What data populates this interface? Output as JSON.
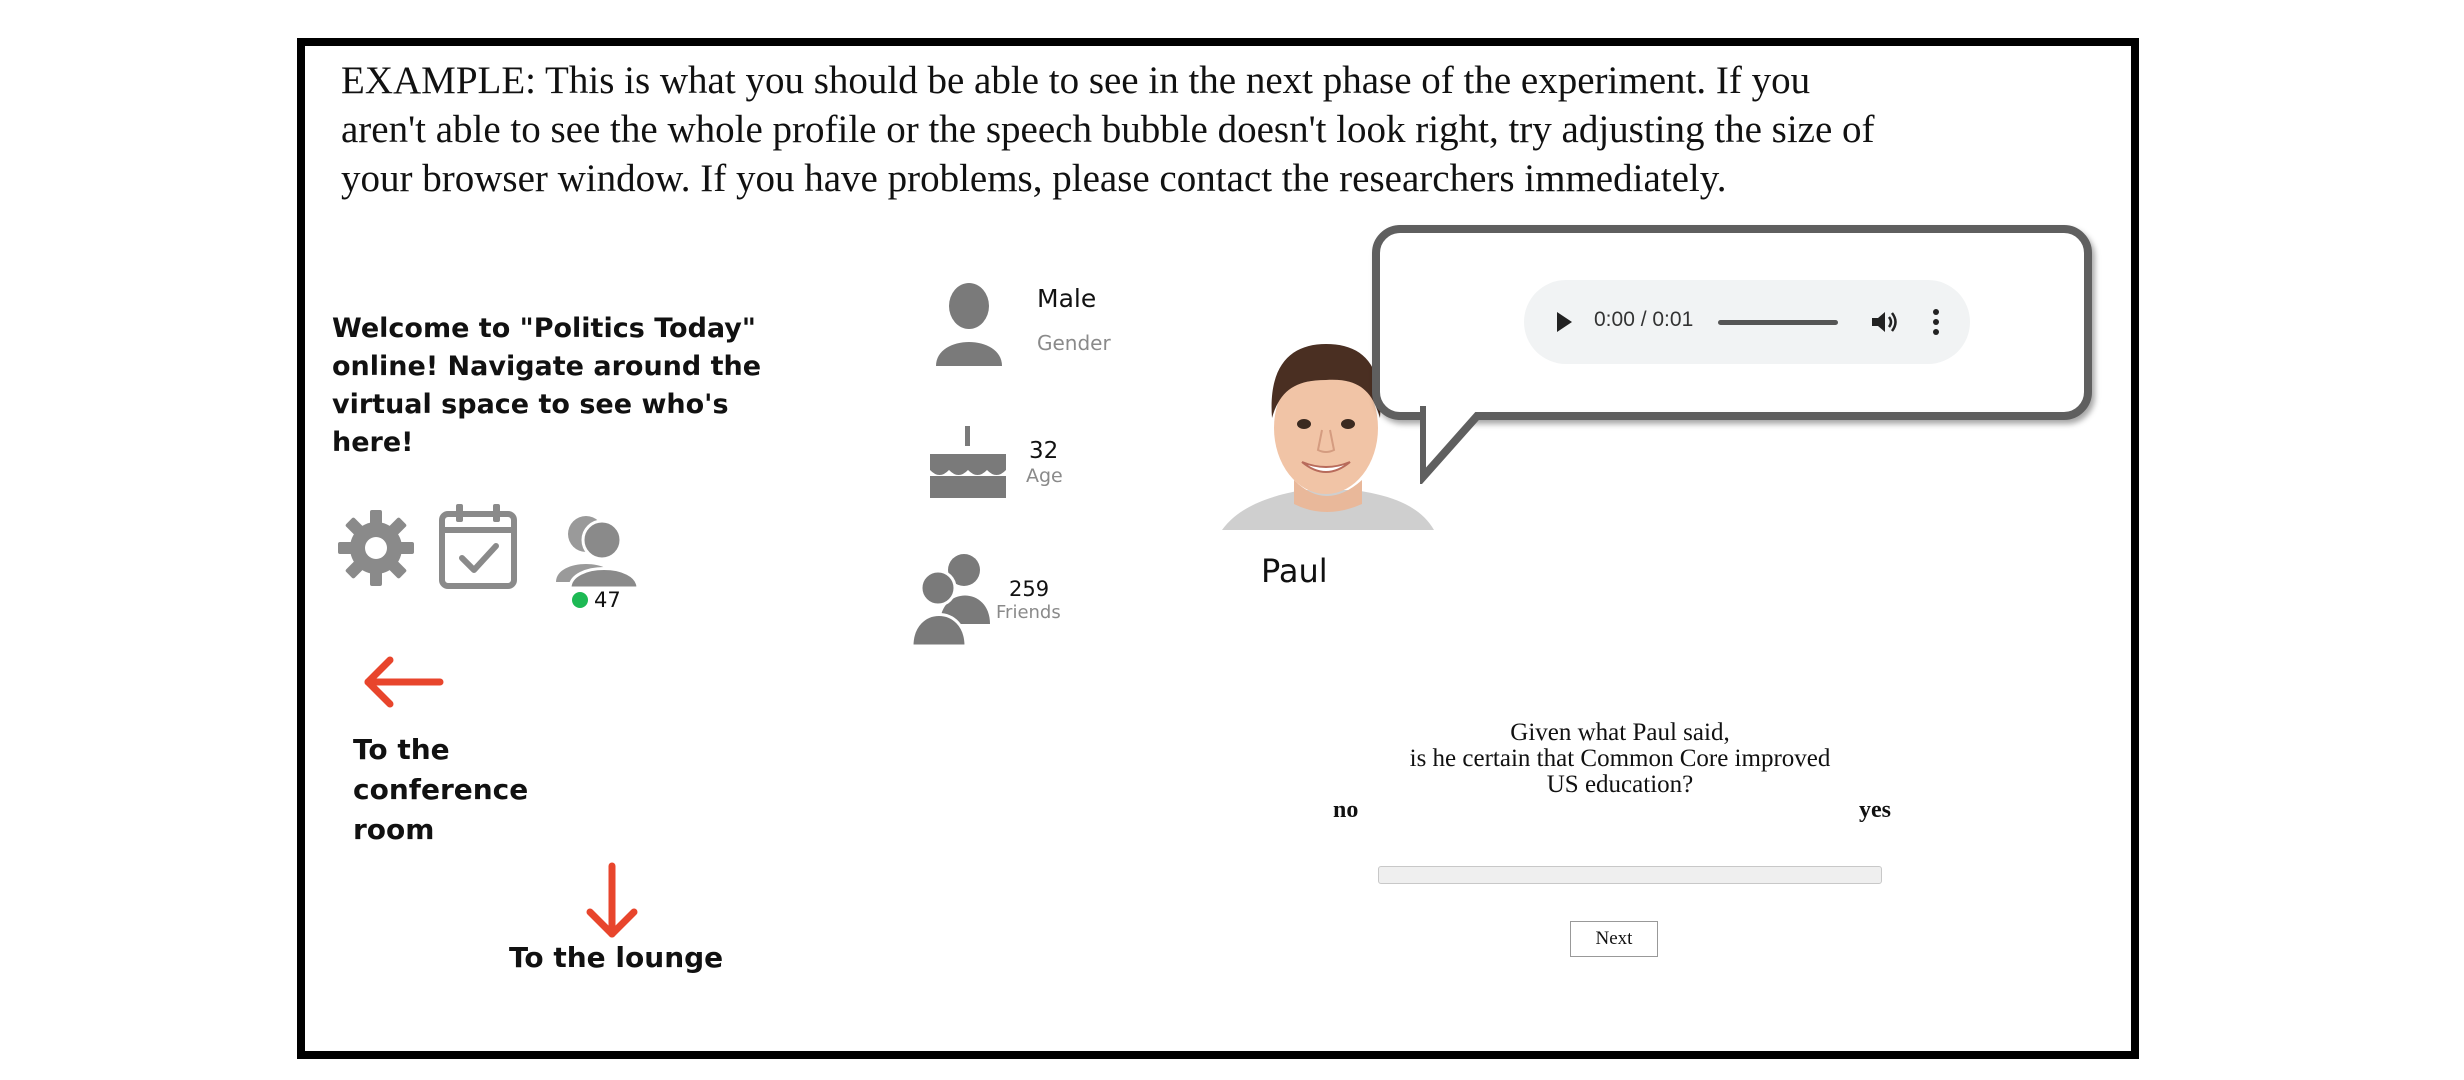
{
  "intro_text": "EXAMPLE: This is what you should be able to see in the next phase of the experiment. If you aren't able to see the whole profile or the speech bubble doesn't look right, try adjusting the size of your browser window.  If you have problems, please contact the researchers immediately.",
  "welcome_text": "Welcome to \"Politics Today\" online! Navigate around the virtual space to see who's here!",
  "toolbar": {
    "settings_icon": "gear-icon",
    "calendar_icon": "calendar-check-icon",
    "users_icon": "users-icon",
    "online_count": "47"
  },
  "navigation": {
    "conference_label": "To the conference room",
    "lounge_label": "To the lounge"
  },
  "profile": {
    "gender_value": "Male",
    "gender_label": "Gender",
    "age_value": "32",
    "age_label": "Age",
    "friends_value": "259",
    "friends_label": "Friends",
    "name": "Paul"
  },
  "audio": {
    "time": "0:00 / 0:01"
  },
  "question": {
    "line1": "Given what  Paul said,",
    "line2": "is  he  certain that  Common Core improved",
    "line3": "US education?",
    "scale_min": "no",
    "scale_max": "yes",
    "next_label": "Next"
  },
  "colors": {
    "arrow": "#e8452c",
    "icon_gray": "#7a7a7a",
    "online": "#1db954"
  }
}
